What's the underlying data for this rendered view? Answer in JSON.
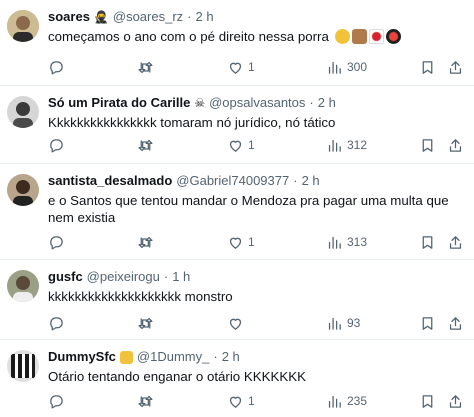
{
  "posts": [
    {
      "name": "soares",
      "handle": "@soares_rz",
      "time": "2 h",
      "text": "começamos o ano com o pé direito nessa porra",
      "replies": "",
      "reposts": "",
      "likes": "1",
      "views": "300",
      "avatar_color": "#c9b48a",
      "emojis": [
        "money-mouth-face",
        "middle-finger",
        "japan-flag",
        "sushi"
      ]
    },
    {
      "name": "Só um Pirata do Carille",
      "handle": "@opsalvasantos",
      "time": "2 h",
      "text": "Kkkkkkkkkkkkkkkk tomaram nó jurídico, nó tático",
      "replies": "",
      "reposts": "",
      "likes": "1",
      "views": "312",
      "avatar_color": "#3a3a3a",
      "badge": "skull-crossbones"
    },
    {
      "name": "santista_desalmado",
      "handle": "@Gabriel74009377",
      "time": "2 h",
      "text": "e o Santos que tentou mandar o Mendoza pra pagar uma multa que nem existia",
      "replies": "",
      "reposts": "",
      "likes": "1",
      "views": "313",
      "avatar_color": "#5a4a3a"
    },
    {
      "name": "gusfc",
      "handle": "@peixeirogu",
      "time": "1 h",
      "text": "kkkkkkkkkkkkkkkkkkkk monstro",
      "replies": "",
      "reposts": "",
      "likes": "",
      "views": "93",
      "avatar_color": "#7a8a6a"
    },
    {
      "name": "DummySfc",
      "handle": "@1Dummy_",
      "time": "2 h",
      "text": "Otário tentando enganar o otário KKKKKKK",
      "replies": "",
      "reposts": "",
      "likes": "1",
      "views": "235",
      "avatar_color": "#2d2d2d",
      "badge": "fist-bump"
    }
  ],
  "sep": "·"
}
